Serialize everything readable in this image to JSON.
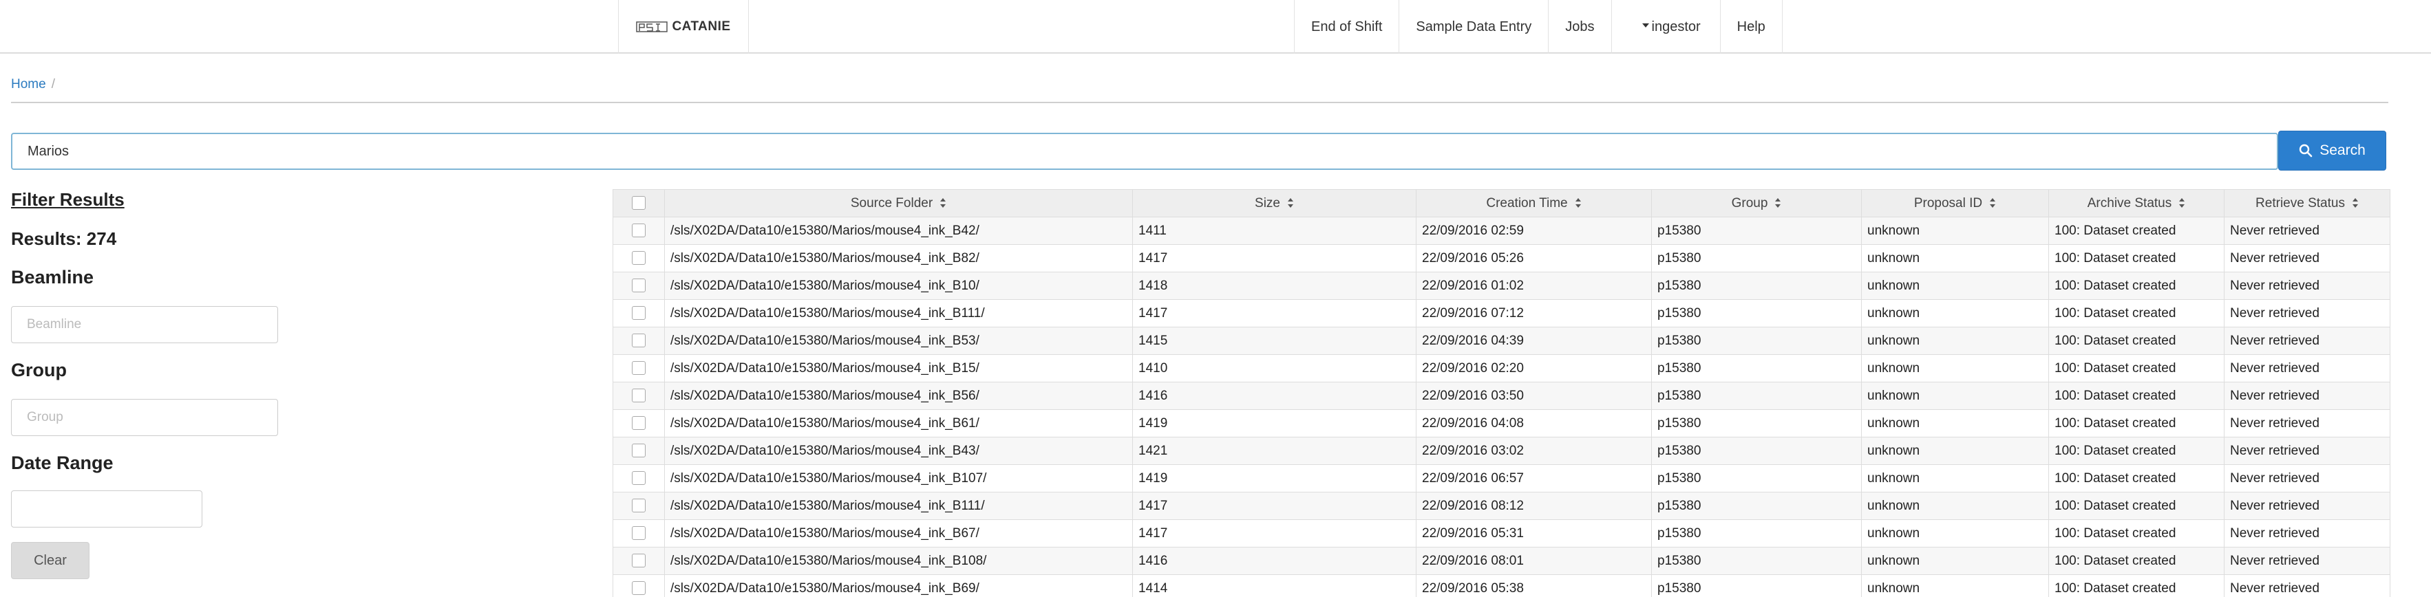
{
  "navbar": {
    "brand": "CATANIE",
    "logo_icon": "psi-logo-icon",
    "items": [
      {
        "label": "End of Shift"
      },
      {
        "label": "Sample Data Entry"
      },
      {
        "label": "Jobs"
      },
      {
        "label": "ingestor",
        "icon": "caret-down-icon"
      },
      {
        "label": "Help"
      }
    ]
  },
  "breadcrumb": {
    "home": "Home",
    "separator": "/"
  },
  "search": {
    "value": "Marios",
    "button_label": "Search",
    "button_icon": "search-icon",
    "button_color": "#2b7fcf"
  },
  "filters": {
    "title": "Filter Results",
    "results_label": "Results: 274",
    "beamline": {
      "label": "Beamline",
      "placeholder": "Beamline"
    },
    "group": {
      "label": "Group",
      "placeholder": "Group"
    },
    "date_range": {
      "label": "Date Range",
      "value": ""
    },
    "clear_label": "Clear"
  },
  "table": {
    "columns": [
      "Source Folder",
      "Size",
      "Creation Time",
      "Group",
      "Proposal ID",
      "Archive Status",
      "Retrieve Status"
    ],
    "rows": [
      [
        "/sls/X02DA/Data10/e15380/Marios/mouse4_ink_B42/",
        "1411",
        "22/09/2016 02:59",
        "p15380",
        "unknown",
        "100: Dataset created",
        "Never retrieved"
      ],
      [
        "/sls/X02DA/Data10/e15380/Marios/mouse4_ink_B82/",
        "1417",
        "22/09/2016 05:26",
        "p15380",
        "unknown",
        "100: Dataset created",
        "Never retrieved"
      ],
      [
        "/sls/X02DA/Data10/e15380/Marios/mouse4_ink_B10/",
        "1418",
        "22/09/2016 01:02",
        "p15380",
        "unknown",
        "100: Dataset created",
        "Never retrieved"
      ],
      [
        "/sls/X02DA/Data10/e15380/Marios/mouse4_ink_B111/",
        "1417",
        "22/09/2016 07:12",
        "p15380",
        "unknown",
        "100: Dataset created",
        "Never retrieved"
      ],
      [
        "/sls/X02DA/Data10/e15380/Marios/mouse4_ink_B53/",
        "1415",
        "22/09/2016 04:39",
        "p15380",
        "unknown",
        "100: Dataset created",
        "Never retrieved"
      ],
      [
        "/sls/X02DA/Data10/e15380/Marios/mouse4_ink_B15/",
        "1410",
        "22/09/2016 02:20",
        "p15380",
        "unknown",
        "100: Dataset created",
        "Never retrieved"
      ],
      [
        "/sls/X02DA/Data10/e15380/Marios/mouse4_ink_B56/",
        "1416",
        "22/09/2016 03:50",
        "p15380",
        "unknown",
        "100: Dataset created",
        "Never retrieved"
      ],
      [
        "/sls/X02DA/Data10/e15380/Marios/mouse4_ink_B61/",
        "1419",
        "22/09/2016 04:08",
        "p15380",
        "unknown",
        "100: Dataset created",
        "Never retrieved"
      ],
      [
        "/sls/X02DA/Data10/e15380/Marios/mouse4_ink_B43/",
        "1421",
        "22/09/2016 03:02",
        "p15380",
        "unknown",
        "100: Dataset created",
        "Never retrieved"
      ],
      [
        "/sls/X02DA/Data10/e15380/Marios/mouse4_ink_B107/",
        "1419",
        "22/09/2016 06:57",
        "p15380",
        "unknown",
        "100: Dataset created",
        "Never retrieved"
      ],
      [
        "/sls/X02DA/Data10/e15380/Marios/mouse4_ink_B111/",
        "1417",
        "22/09/2016 08:12",
        "p15380",
        "unknown",
        "100: Dataset created",
        "Never retrieved"
      ],
      [
        "/sls/X02DA/Data10/e15380/Marios/mouse4_ink_B67/",
        "1417",
        "22/09/2016 05:31",
        "p15380",
        "unknown",
        "100: Dataset created",
        "Never retrieved"
      ],
      [
        "/sls/X02DA/Data10/e15380/Marios/mouse4_ink_B108/",
        "1416",
        "22/09/2016 08:01",
        "p15380",
        "unknown",
        "100: Dataset created",
        "Never retrieved"
      ],
      [
        "/sls/X02DA/Data10/e15380/Marios/mouse4_ink_B69/",
        "1414",
        "22/09/2016 05:38",
        "p15380",
        "unknown",
        "100: Dataset created",
        "Never retrieved"
      ]
    ]
  }
}
